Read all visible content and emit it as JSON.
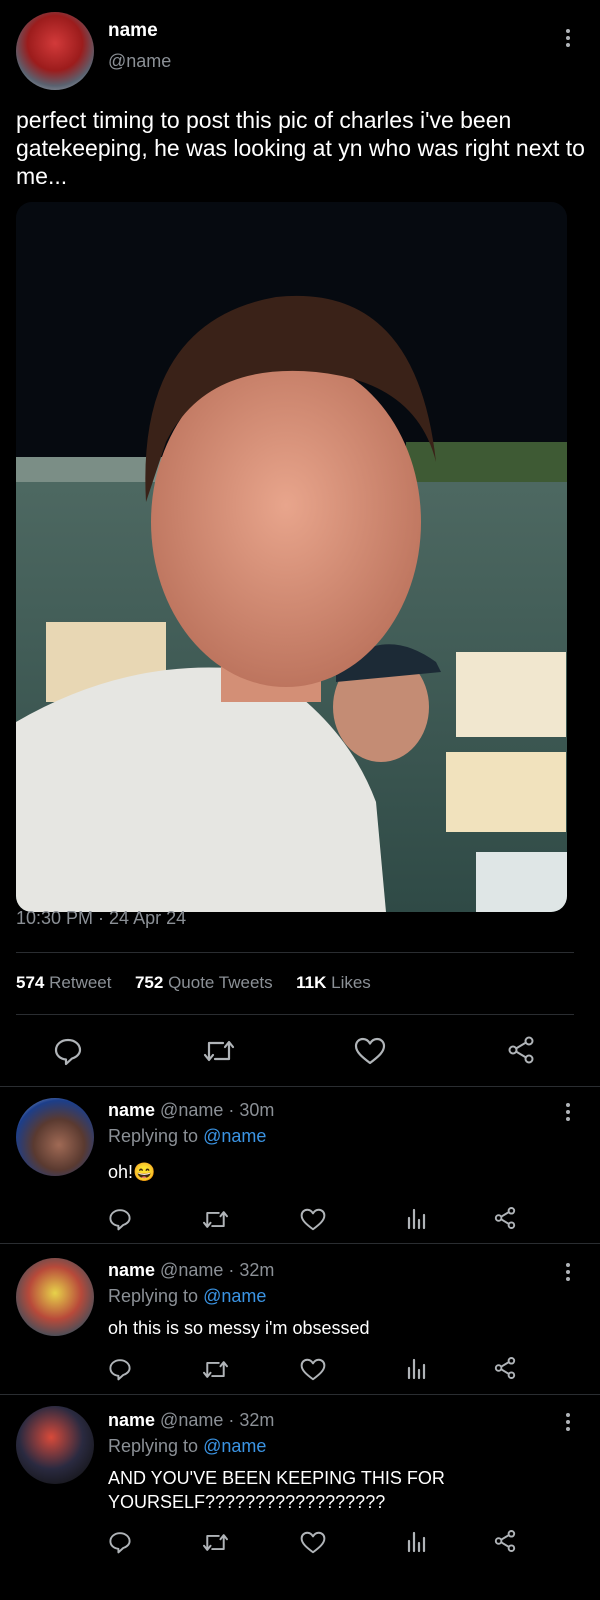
{
  "tweet": {
    "display_name": "name",
    "handle": "@name",
    "text": "perfect timing to post this pic of charles i've been gatekeeping, he was looking at yn who was right next to me...",
    "timestamp": "10:30 PM · 24 Apr 24",
    "stats": {
      "retweet_count": "574",
      "retweet_label": "Retweet",
      "quote_count": "752",
      "quote_label": "Quote Tweets",
      "like_count": "11K",
      "like_label": "Likes"
    },
    "actions": [
      "reply-icon",
      "retweet-icon",
      "like-icon",
      "share-icon"
    ]
  },
  "replies": [
    {
      "display_name": "name",
      "handle": "@name",
      "time": "· 30m",
      "replying_label": "Replying to",
      "replying_to": "@name",
      "text": "oh!😄"
    },
    {
      "display_name": "name",
      "handle": "@name",
      "time": "· 32m",
      "replying_label": "Replying to",
      "replying_to": "@name",
      "text": "oh this is so messy i'm obsessed"
    },
    {
      "display_name": "name",
      "handle": "@name",
      "time": "· 32m",
      "replying_label": "Replying to",
      "replying_to": "@name",
      "text": "AND YOU'VE BEEN KEEPING THIS FOR YOURSELF??????????????????"
    }
  ],
  "colors": {
    "background": "#000000",
    "muted": "#8b9096",
    "link": "#3b94e3",
    "divider": "#2a2d31"
  }
}
